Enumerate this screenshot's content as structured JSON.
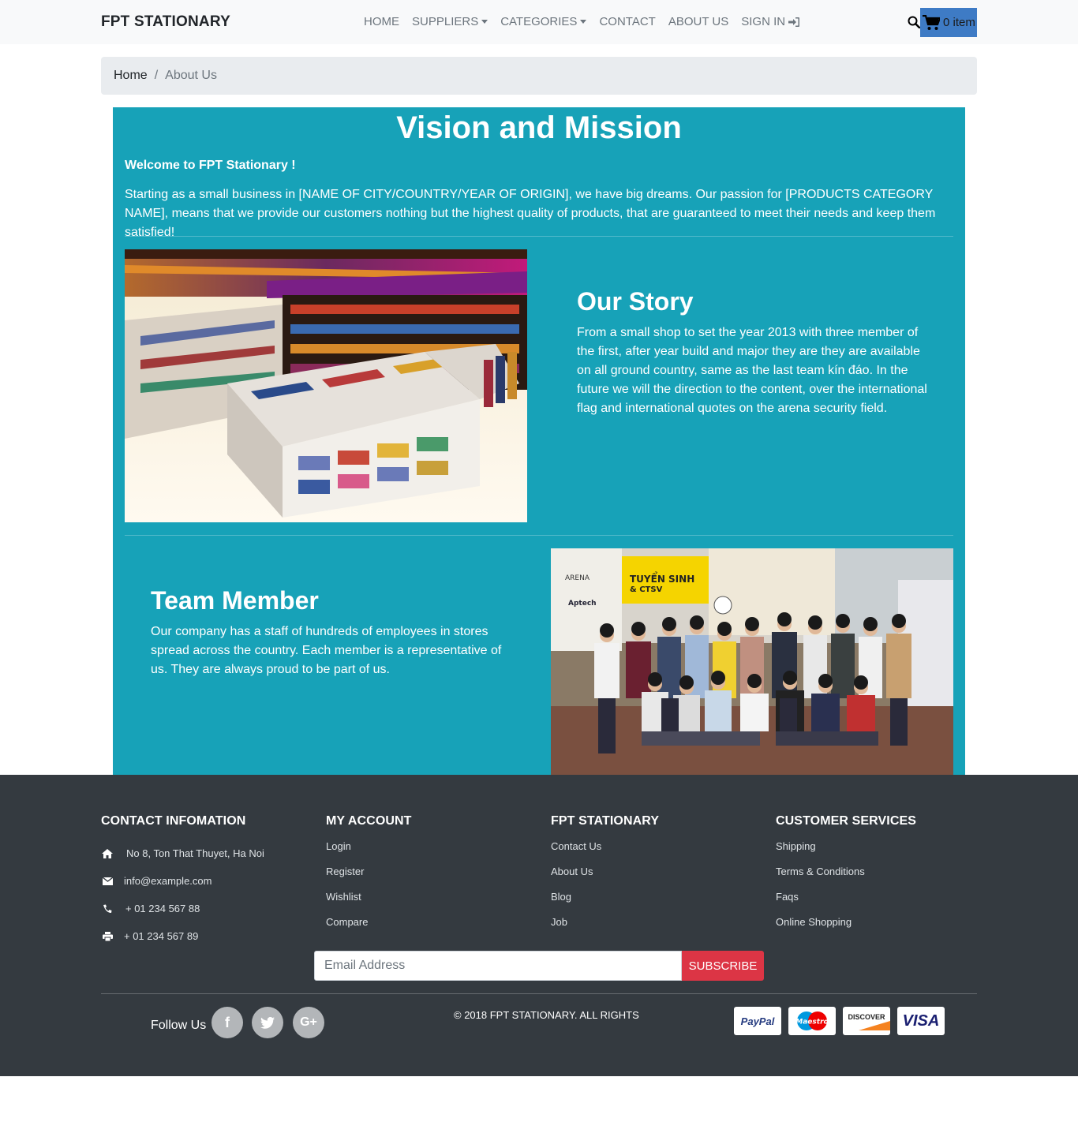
{
  "navbar": {
    "brand": "FPT STATIONARY",
    "items": [
      {
        "label": "HOME"
      },
      {
        "label": "SUPPLIERS"
      },
      {
        "label": "CATEGORIES"
      },
      {
        "label": "CONTACT"
      },
      {
        "label": "ABOUT US"
      },
      {
        "label": "SIGN IN"
      }
    ],
    "cart_label": "0 item",
    "icons": {
      "search": "search-icon",
      "cart": "cart-icon",
      "signin": "sign-in-icon"
    }
  },
  "breadcrumb": {
    "home": "Home",
    "separator": "/",
    "current": "About Us"
  },
  "main": {
    "title": "Vision and Mission",
    "welcome": "Welcome to FPT Stationary !",
    "intro": "Starting as a small business in [NAME OF CITY/COUNTRY/YEAR OF ORIGIN], we have big dreams. Our passion for [PRODUCTS CATEGORY NAME], means that we provide our customers nothing but the highest quality of products, that are guaranteed to meet their needs and keep them satisfied!",
    "story": {
      "title": "Our Story",
      "text": "From a small shop to set the year 2013 with three member of the first, after year build and major they are they are available on all ground country, same as the last team kín đáo. In the future we will the direction to the content, over the international flag and international quotes on the arena security field."
    },
    "team": {
      "title": "Team Member",
      "text": "Our company has a staff of hundreds of employees in stores spread across the country. Each member is a representative of us. They are always proud to be part of us.",
      "photo_sign": "TUYỂN SINH",
      "photo_sign2": "& CTSV",
      "photo_logo": "ARENA",
      "photo_logo2": "Aptech"
    },
    "accent_color": "#17a2b8"
  },
  "footer": {
    "contact": {
      "title": "CONTACT INFOMATION",
      "address": "No 8, Ton That Thuyet, Ha Noi",
      "email": "info@example.com",
      "phone": "+ 01 234 567 88",
      "fax": "+ 01 234 567 89"
    },
    "account": {
      "title": "MY ACCOUNT",
      "links": [
        "Login",
        "Register",
        "Wishlist",
        "Compare"
      ]
    },
    "fpt": {
      "title": "FPT STATIONARY",
      "links": [
        "Contact Us",
        "About Us",
        "Blog",
        "Job"
      ]
    },
    "services": {
      "title": "CUSTOMER SERVICES",
      "links": [
        "Shipping",
        "Terms & Conditions",
        "Faqs",
        "Online Shopping"
      ]
    },
    "subscribe": {
      "placeholder": "Email Address",
      "button": "SUBSCRIBE"
    },
    "follow_label": "Follow Us",
    "social": [
      "f",
      "t",
      "G+"
    ],
    "copyright": "© 2018 FPT STATIONARY. ALL RIGHTS",
    "payments": [
      "PayPal",
      "Maestro",
      "DISCOVER",
      "VISA"
    ],
    "background_color": "#343a40",
    "subscribe_color": "#dc3545"
  }
}
